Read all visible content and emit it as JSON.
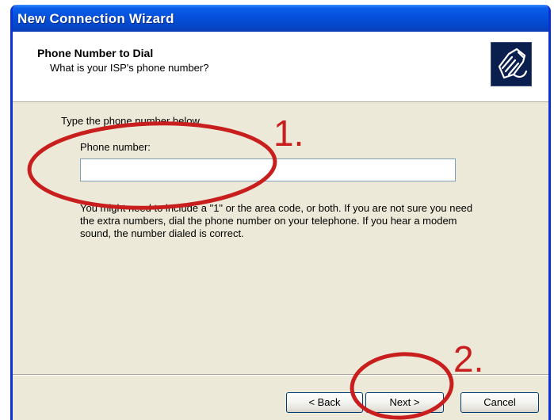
{
  "window": {
    "title": "New Connection Wizard"
  },
  "header": {
    "title": "Phone Number to Dial",
    "subtitle": "What is your ISP's phone number?",
    "icon": "telephone-icon"
  },
  "body": {
    "instruction": "Type the phone number below.",
    "phone_label": "Phone number:",
    "phone_value": "",
    "hint": "You might need to include a \"1\" or the area code, or both. If you are not sure you need the extra numbers, dial the phone number on your telephone. If you hear a modem sound, the number dialed is correct."
  },
  "buttons": {
    "back": "< Back",
    "next": "Next >",
    "cancel": "Cancel"
  },
  "annotations": {
    "step1": "1.",
    "step2": "2.",
    "color": "#c91e1e"
  }
}
